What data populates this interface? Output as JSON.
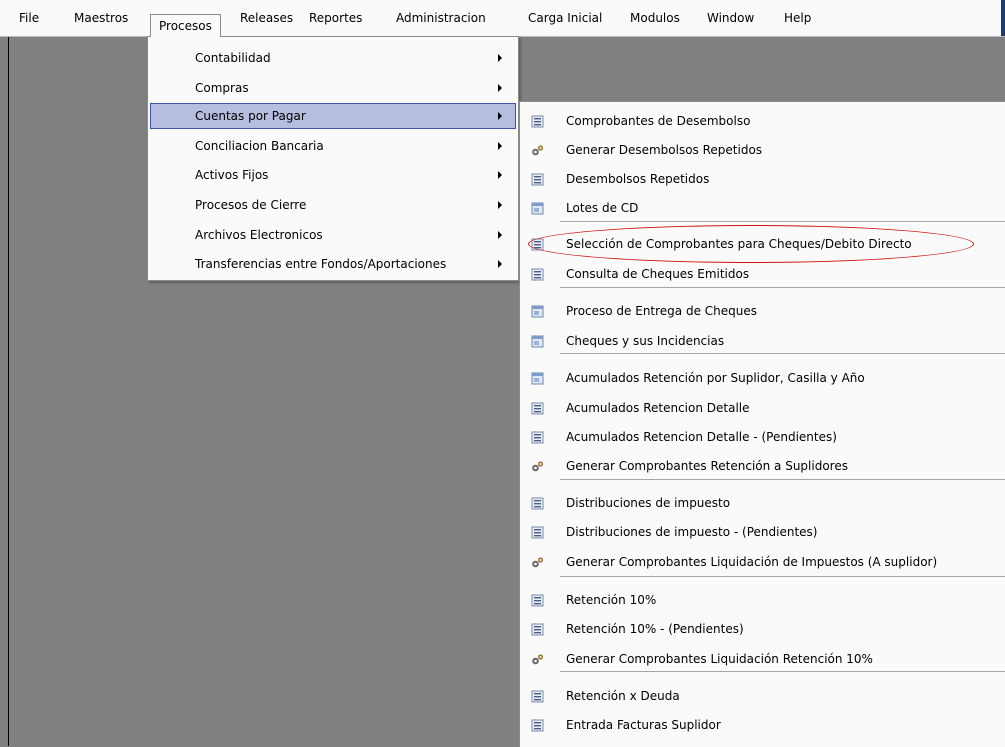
{
  "menubar": {
    "items": [
      {
        "label": "File"
      },
      {
        "label": "Maestros"
      },
      {
        "label": "Procesos"
      },
      {
        "label": "Releases"
      },
      {
        "label": "Reportes"
      },
      {
        "label": "Administracion"
      },
      {
        "label": "Carga Inicial"
      },
      {
        "label": "Modulos"
      },
      {
        "label": "Window"
      },
      {
        "label": "Help"
      }
    ]
  },
  "procesos_menu": {
    "items": [
      {
        "label": "Contabilidad"
      },
      {
        "label": "Compras"
      },
      {
        "label": "Cuentas por Pagar"
      },
      {
        "label": "Conciliacion Bancaria"
      },
      {
        "label": "Activos Fijos"
      },
      {
        "label": "Procesos de Cierre"
      },
      {
        "label": "Archivos Electronicos"
      },
      {
        "label": "Transferencias entre Fondos/Aportaciones"
      }
    ]
  },
  "cuentas_por_pagar_menu": {
    "items": [
      {
        "label": "Comprobantes de Desembolso",
        "icon": "list-icon"
      },
      {
        "label": "Generar Desembolsos Repetidos",
        "icon": "gears-icon"
      },
      {
        "label": "Desembolsos Repetidos",
        "icon": "list-icon"
      },
      {
        "label": "Lotes de CD",
        "icon": "window-icon"
      },
      {
        "label": "Selección de Comprobantes para Cheques/Debito Directo",
        "icon": "list-icon"
      },
      {
        "label": "Consulta de Cheques Emitidos",
        "icon": "list-icon"
      },
      {
        "label": "Proceso de Entrega de Cheques",
        "icon": "window-icon"
      },
      {
        "label": "Cheques y sus Incidencias",
        "icon": "window-icon"
      },
      {
        "label": "Acumulados Retención por Suplidor, Casilla y Año",
        "icon": "window-icon"
      },
      {
        "label": "Acumulados Retencion Detalle",
        "icon": "list-icon"
      },
      {
        "label": "Acumulados Retencion Detalle -  (Pendientes)",
        "icon": "list-icon"
      },
      {
        "label": "Generar Comprobantes Retención a Suplidores",
        "icon": "gears-icon"
      },
      {
        "label": "Distribuciones de impuesto",
        "icon": "list-icon"
      },
      {
        "label": "Distribuciones de impuesto - (Pendientes)",
        "icon": "list-icon"
      },
      {
        "label": "Generar Comprobantes Liquidación de Impuestos (A suplidor)",
        "icon": "gears-icon"
      },
      {
        "label": "Retención 10%",
        "icon": "list-icon"
      },
      {
        "label": "Retención 10% - (Pendientes)",
        "icon": "list-icon"
      },
      {
        "label": "Generar Comprobantes Liquidación Retención 10%",
        "icon": "gears-icon"
      },
      {
        "label": "Retención x Deuda",
        "icon": "list-icon"
      },
      {
        "label": "Entrada Facturas Suplidor",
        "icon": "list-icon"
      }
    ]
  },
  "colors": {
    "highlight": "#b6bedf",
    "highlight_border": "#3a55a5",
    "annotation": "#cc1111",
    "desktop": "#808080"
  }
}
